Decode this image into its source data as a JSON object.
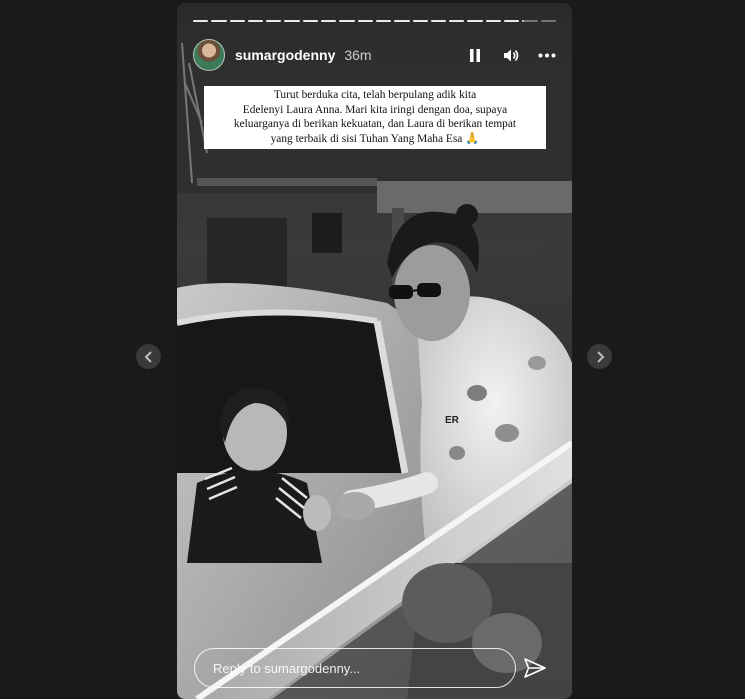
{
  "story": {
    "username": "sumargodenny",
    "time_ago": "36m",
    "progress_segments": 20,
    "current_segment": 19,
    "caption_lines": [
      "Turut berduka cita, telah berpulang adik kita",
      "Edelenyi Laura Anna. Mari kita iringi dengan doa, supaya",
      "keluarganya di berikan kekuatan, dan Laura di berikan tempat",
      "yang terbaik di sisi Tuhan Yang Maha Esa 🙏"
    ],
    "photo_description_icon": "black-and-white-photo",
    "hoodie_text": "ER"
  },
  "controls": {
    "pause_icon": "pause-icon",
    "volume_icon": "volume-icon",
    "more_icon": "more-icon"
  },
  "reply": {
    "placeholder": "Reply to sumargodenny..."
  },
  "colors": {
    "background": "#1a1a1a",
    "nav_button": "#3a3a3a",
    "text": "#ffffff"
  }
}
